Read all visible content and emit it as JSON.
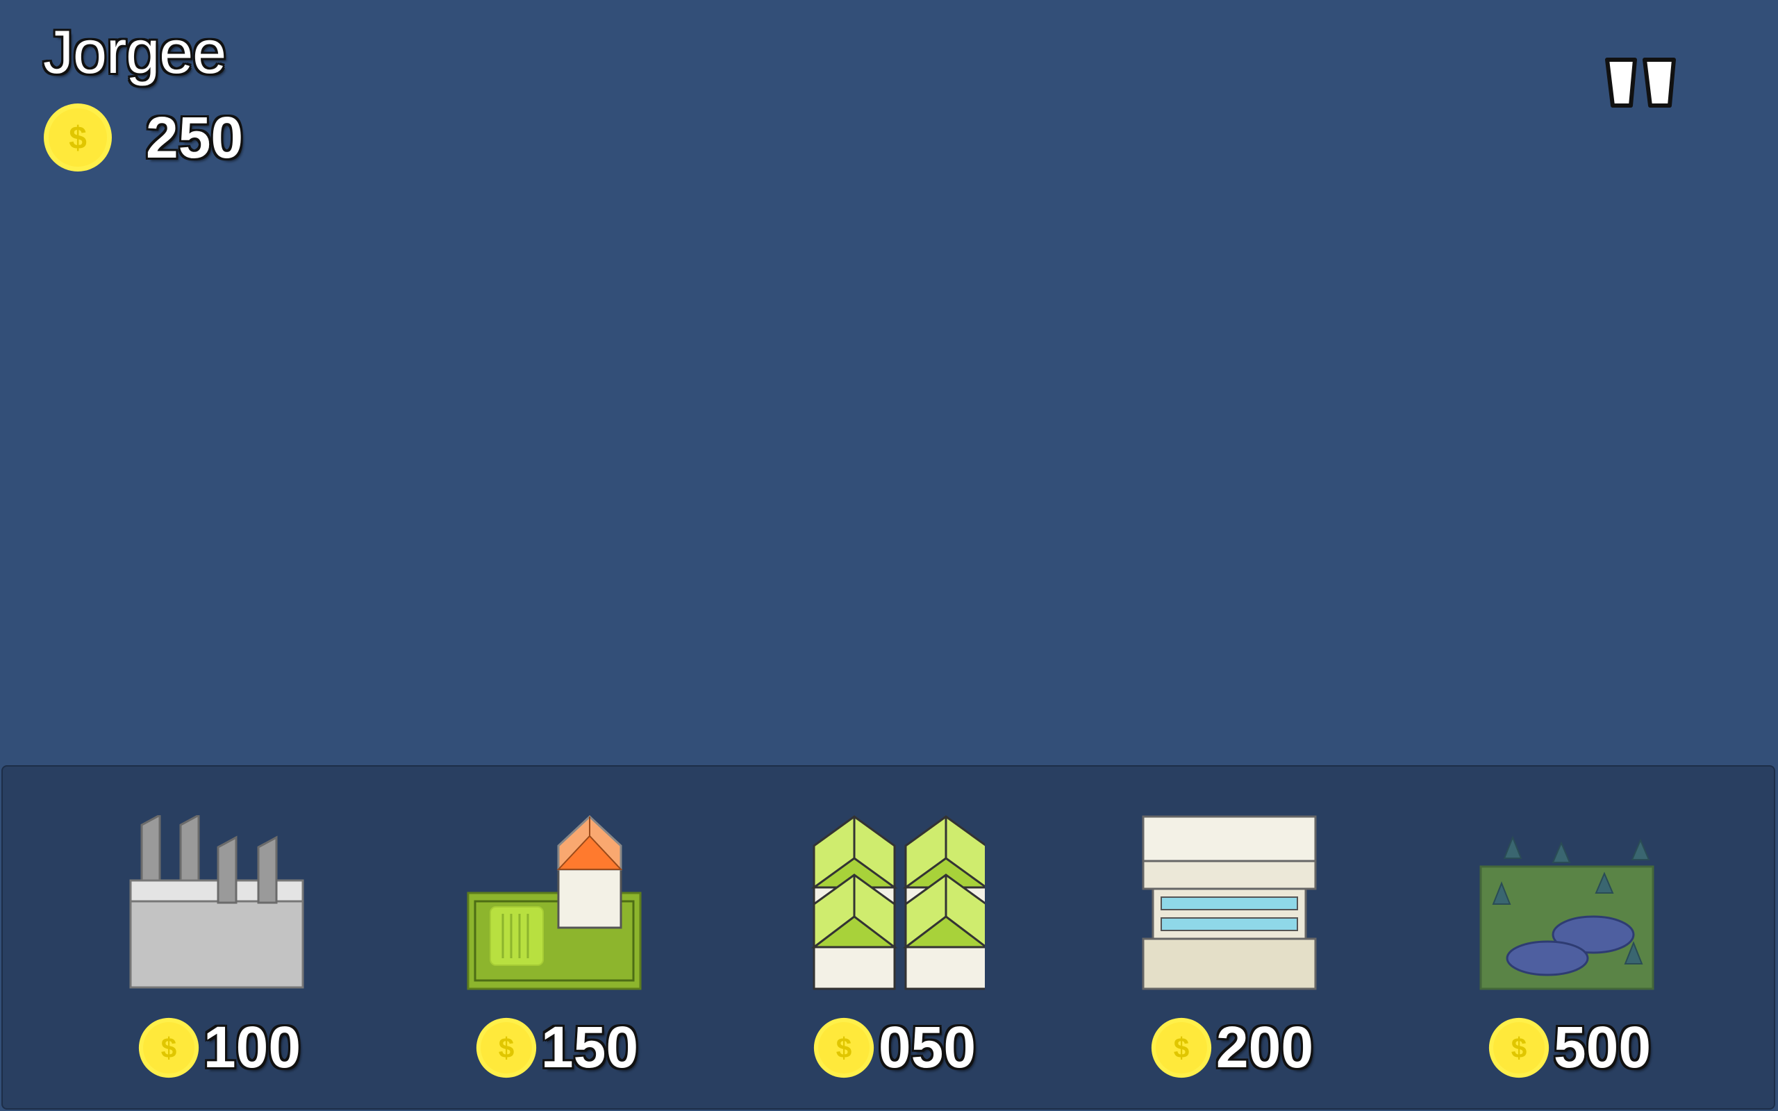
{
  "hud": {
    "player_name": "Jorgee",
    "balance": "250",
    "balance_icon": "coin-icon",
    "pause_icon": "pause-icon"
  },
  "colors": {
    "background": "#334f78",
    "panel": "#293f61",
    "coin": "#ffe93b",
    "coin_symbol": "#e5c800"
  },
  "build_menu": {
    "items": [
      {
        "name": "factory",
        "icon": "factory-icon",
        "price": "100"
      },
      {
        "name": "house",
        "icon": "house-icon",
        "price": "150"
      },
      {
        "name": "crop-field",
        "icon": "crop-icon",
        "price": "050"
      },
      {
        "name": "office-building",
        "icon": "building-icon",
        "price": "200"
      },
      {
        "name": "park",
        "icon": "park-icon",
        "price": "500"
      }
    ]
  }
}
